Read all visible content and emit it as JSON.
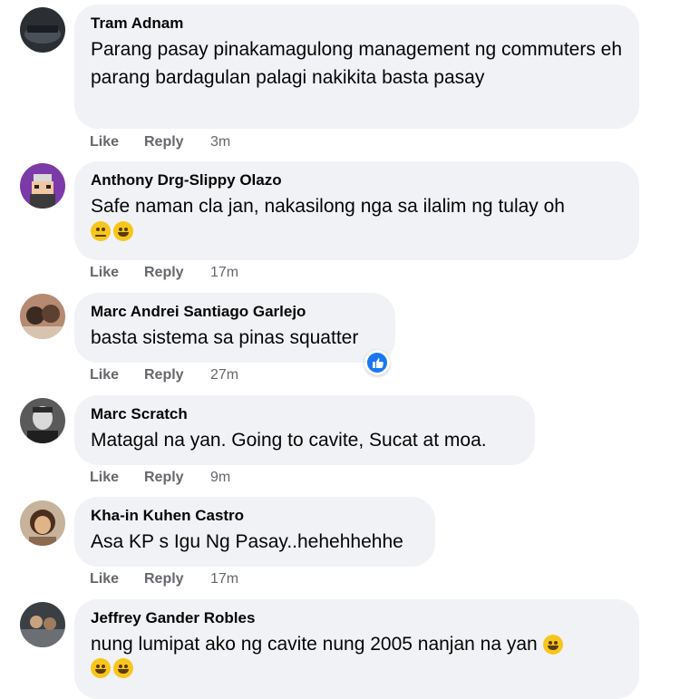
{
  "actions": {
    "like": "Like",
    "reply": "Reply"
  },
  "comments": [
    {
      "author": "Tram Adnam",
      "text": "Parang pasay pinakamagulong management ng commuters eh parang bardagulan palagi nakikita basta pasay",
      "time": "3m"
    },
    {
      "author": "Anthony Drg-Slippy Olazo",
      "text": "Safe naman cla jan, nakasilong nga sa ilalim ng tulay oh",
      "emojis": [
        "pensive-face",
        "grinning-face"
      ],
      "time": "17m"
    },
    {
      "author": "Marc Andrei Santiago Garlejo",
      "text": "basta sistema sa pinas squatter",
      "time": "27m",
      "reaction": "like-reaction-icon"
    },
    {
      "author": "Marc Scratch",
      "text": "Matagal na yan. Going to cavite, Sucat at moa.",
      "time": "9m"
    },
    {
      "author": "Kha-in Kuhen Castro",
      "text": "Asa KP s Igu Ng Pasay..hehehhehhe",
      "time": "17m"
    },
    {
      "author": "Jeffrey Gander Robles",
      "text": "nung lumipat ako ng cavite nung 2005 nanjan na yan",
      "emojis": [
        "rolling-laughing-face",
        "rolling-laughing-face",
        "rolling-laughing-face"
      ]
    }
  ]
}
